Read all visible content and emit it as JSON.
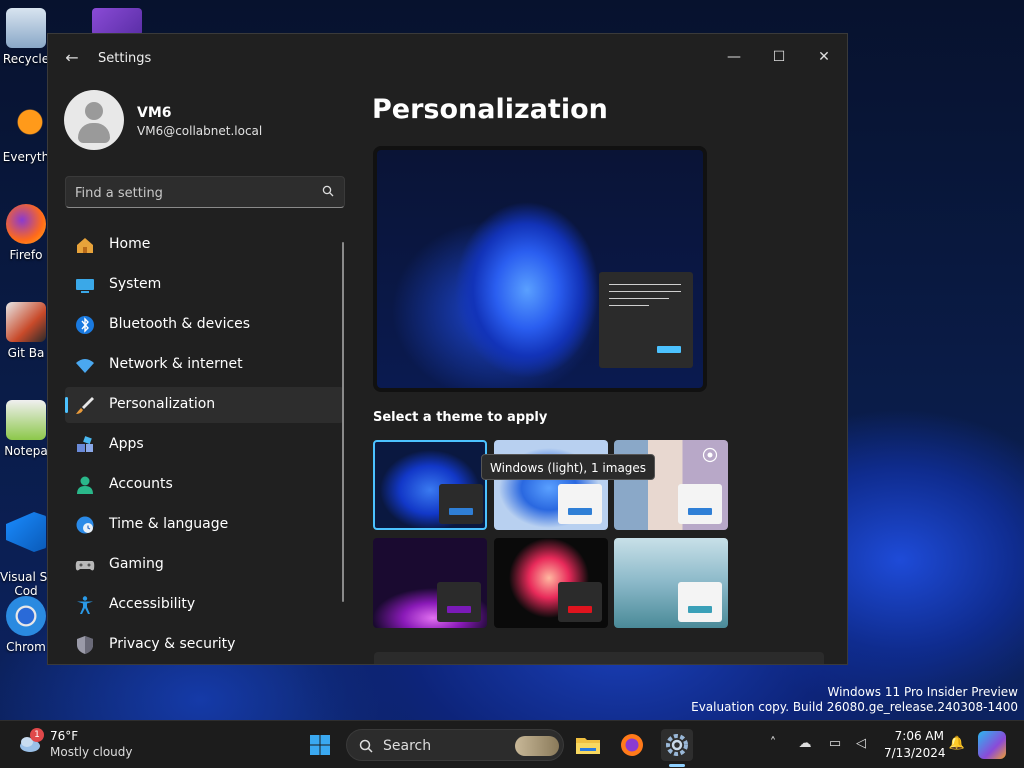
{
  "desktop": {
    "icons": [
      {
        "label": "Recycle"
      },
      {
        "label": "Everyth"
      },
      {
        "label": "Firefo"
      },
      {
        "label": "Git Ba"
      },
      {
        "label": "Notepa"
      },
      {
        "label": "Visual St\nCod"
      },
      {
        "label": "Chrom"
      }
    ],
    "watermark": {
      "line1": "Windows 11 Pro Insider Preview",
      "line2": "Evaluation copy. Build 26080.ge_release.240308-1400"
    }
  },
  "window": {
    "title": "Settings",
    "controls": {
      "minimize": "—",
      "maximize": "☐",
      "close": "✕"
    }
  },
  "profile": {
    "name": "VM6",
    "email": "VM6@collabnet.local"
  },
  "search": {
    "placeholder": "Find a setting"
  },
  "nav": {
    "items": [
      {
        "label": "Home",
        "icon": "home-icon"
      },
      {
        "label": "System",
        "icon": "monitor-icon"
      },
      {
        "label": "Bluetooth & devices",
        "icon": "bluetooth-icon"
      },
      {
        "label": "Network & internet",
        "icon": "wifi-icon"
      },
      {
        "label": "Personalization",
        "icon": "brush-icon",
        "active": true
      },
      {
        "label": "Apps",
        "icon": "apps-icon"
      },
      {
        "label": "Accounts",
        "icon": "person-icon"
      },
      {
        "label": "Time & language",
        "icon": "globe-clock-icon"
      },
      {
        "label": "Gaming",
        "icon": "gamepad-icon"
      },
      {
        "label": "Accessibility",
        "icon": "accessibility-icon"
      },
      {
        "label": "Privacy & security",
        "icon": "shield-icon"
      }
    ]
  },
  "main": {
    "title": "Personalization",
    "section_label": "Select a theme to apply",
    "tooltip": "Windows (light), 1 images",
    "themes": [
      {
        "id": "windows-dark",
        "selected": true,
        "accent": "#2f7fd6"
      },
      {
        "id": "windows-light",
        "accent": "#2f7fd6"
      },
      {
        "id": "spotlight",
        "accent": "#2f7fd6"
      },
      {
        "id": "glow",
        "accent": "#7a1ab8"
      },
      {
        "id": "captured-motion",
        "accent": "#e0141e"
      },
      {
        "id": "flow",
        "accent": "#3aa0b8"
      }
    ]
  },
  "taskbar": {
    "weather": {
      "temp": "76°F",
      "desc": "Mostly cloudy",
      "badge": "1"
    },
    "search_label": "Search",
    "clock": {
      "time": "7:06 AM",
      "date": "7/13/2024"
    }
  },
  "colors": {
    "accent": "#4cc2ff",
    "window_bg": "#202020"
  }
}
